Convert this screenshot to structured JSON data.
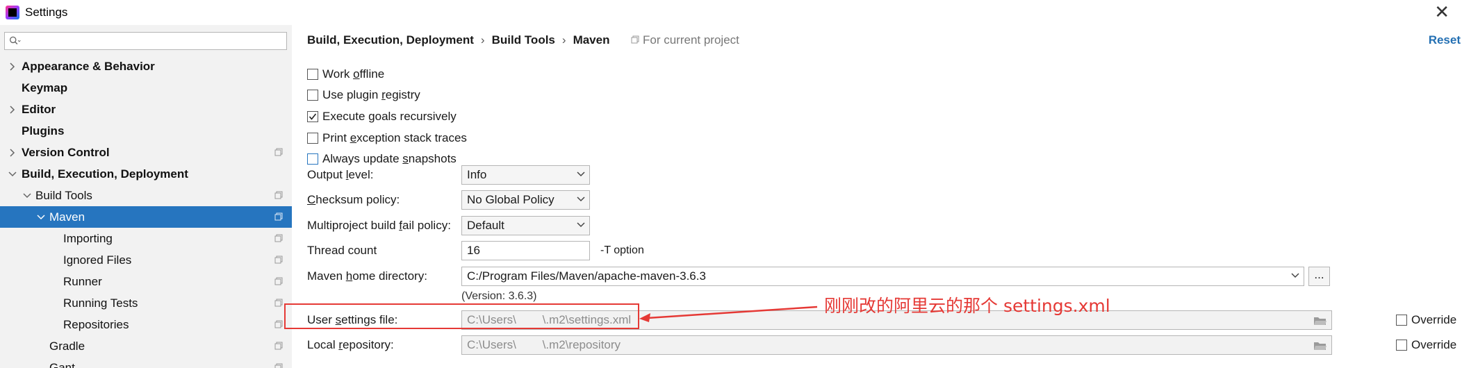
{
  "window": {
    "title": "Settings",
    "close": "✕"
  },
  "sidebar": {
    "search_placeholder": "",
    "items": [
      {
        "label": "Appearance & Behavior"
      },
      {
        "label": "Keymap"
      },
      {
        "label": "Editor"
      },
      {
        "label": "Plugins"
      },
      {
        "label": "Version Control"
      },
      {
        "label": "Build, Execution, Deployment"
      },
      {
        "label": "Build Tools"
      },
      {
        "label": "Maven"
      },
      {
        "label": "Importing"
      },
      {
        "label": "Ignored Files"
      },
      {
        "label": "Runner"
      },
      {
        "label": "Running Tests"
      },
      {
        "label": "Repositories"
      },
      {
        "label": "Gradle"
      },
      {
        "label": "Gant"
      }
    ]
  },
  "breadcrumb": {
    "items": [
      "Build, Execution, Deployment",
      "Build Tools",
      "Maven"
    ],
    "sep": "›",
    "scope": "For current project"
  },
  "reset_label": "Reset",
  "checkboxes": [
    {
      "pre": "Work ",
      "key": "o",
      "post": "ffline",
      "checked": false
    },
    {
      "pre": "Use plugin ",
      "key": "r",
      "post": "egistry",
      "checked": false
    },
    {
      "pre": "Execute ",
      "key": "g",
      "post": "oals recursively",
      "checked": true
    },
    {
      "pre": "Print ",
      "key": "e",
      "post": "xception stack traces",
      "checked": false
    },
    {
      "pre": "Always update ",
      "key": "s",
      "post": "napshots",
      "checked": false
    }
  ],
  "fields": {
    "output_level": {
      "pre": "Output ",
      "key": "l",
      "post": "evel:",
      "value": "Info"
    },
    "checksum_policy": {
      "pre": "",
      "key": "C",
      "post": "hecksum policy:",
      "value": "No Global Policy"
    },
    "fail_policy": {
      "pre": "Multiproject build ",
      "key": "f",
      "post": "ail policy:",
      "value": "Default"
    },
    "thread_count": {
      "label": "Thread count",
      "value": "16",
      "hint": "-T option"
    },
    "maven_home": {
      "pre": "Maven ",
      "key": "h",
      "post": "ome directory:",
      "value": "C:/Program Files/Maven/apache-maven-3.6.3",
      "version": "(Version: 3.6.3)",
      "browse": "..."
    },
    "user_settings": {
      "pre": "User ",
      "key": "s",
      "post": "ettings file:",
      "value": "C:\\Users\\        \\.m2\\settings.xml",
      "override": "Override"
    },
    "local_repo": {
      "pre": "Local ",
      "key": "r",
      "post": "epository:",
      "value": "C:\\Users\\        \\.m2\\repository",
      "override": "Override"
    }
  },
  "annotation": {
    "text": "刚刚改的阿里云的那个 settings.xml",
    "color": "#e53935"
  },
  "colors": {
    "selection": "#2675bf",
    "link": "#2470b3",
    "sidebar_bg": "#f2f2f2"
  }
}
